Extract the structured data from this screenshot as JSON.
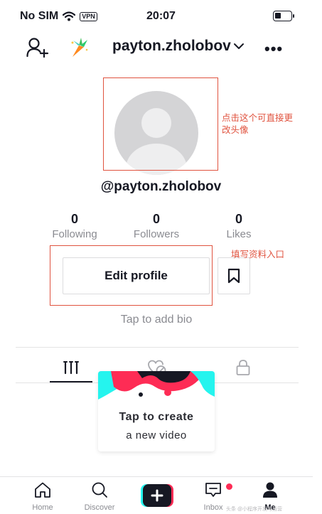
{
  "status_bar": {
    "carrier": "No SIM",
    "vpn": "VPN",
    "time": "20:07"
  },
  "header": {
    "username": "payton.zholobov",
    "more": "•••"
  },
  "profile": {
    "handle": "@payton.zholobov",
    "stats": [
      {
        "value": "0",
        "label": "Following"
      },
      {
        "value": "0",
        "label": "Followers"
      },
      {
        "value": "0",
        "label": "Likes"
      }
    ],
    "edit_button": "Edit profile",
    "bio_placeholder": "Tap to add bio"
  },
  "annotations": {
    "avatar_note_line1": "点击这个可直接更",
    "avatar_note_line2": "改头像",
    "edit_note": "填写资料入口",
    "color": "#e0533f"
  },
  "tabs": [
    {
      "icon": "grid-icon",
      "active": true
    },
    {
      "icon": "liked-heart-icon",
      "active": false
    },
    {
      "icon": "lock-icon",
      "active": false
    }
  ],
  "create_card": {
    "title": "Tap to create",
    "subtitle": "a new video"
  },
  "bottom_nav": {
    "items": [
      {
        "label": "Home",
        "icon": "home-icon"
      },
      {
        "label": "Discover",
        "icon": "search-icon"
      },
      {
        "label": "",
        "icon": "plus-icon"
      },
      {
        "label": "Inbox",
        "icon": "inbox-icon"
      },
      {
        "label": "Me",
        "icon": "person-icon"
      }
    ],
    "watermark": "头条 @小程序开发与运营"
  },
  "colors": {
    "accent_pink": "#fe2c55",
    "accent_cyan": "#25f4ee",
    "text_primary": "#161823",
    "text_secondary": "#8a8b91"
  }
}
